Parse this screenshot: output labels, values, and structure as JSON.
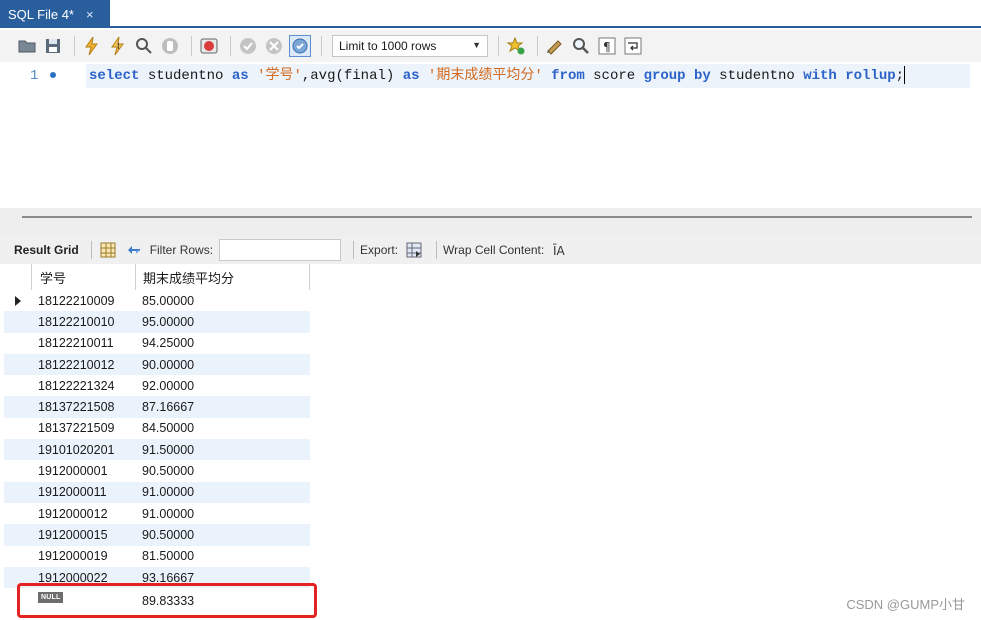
{
  "tab": {
    "label": "SQL File 4*",
    "close": "×"
  },
  "toolbar": {
    "limit_label": "Limit to 1000 rows",
    "icons": [
      "open-folder-icon",
      "save-icon",
      "execute-icon",
      "execute-current-icon",
      "explain-icon",
      "stop-icon",
      "stop-on-error-icon",
      "commit-icon",
      "rollback-icon",
      "autocommit-icon",
      "add-snippet-icon",
      "beautify-icon",
      "find-icon",
      "invisible-chars-icon",
      "wrap-icon"
    ]
  },
  "editor": {
    "line_number": "1",
    "tokens": [
      {
        "t": "select",
        "k": "kw"
      },
      {
        "t": " studentno ",
        "k": "plain"
      },
      {
        "t": "as",
        "k": "kw"
      },
      {
        "t": " ",
        "k": "plain"
      },
      {
        "t": "'学号'",
        "k": "str"
      },
      {
        "t": ",avg(final) ",
        "k": "plain"
      },
      {
        "t": "as",
        "k": "kw"
      },
      {
        "t": " ",
        "k": "plain"
      },
      {
        "t": "'期末成绩平均分'",
        "k": "str"
      },
      {
        "t": " ",
        "k": "plain"
      },
      {
        "t": "from",
        "k": "kw"
      },
      {
        "t": " score ",
        "k": "plain"
      },
      {
        "t": "group by",
        "k": "kw"
      },
      {
        "t": " studentno ",
        "k": "plain"
      },
      {
        "t": "with rollup",
        "k": "kw"
      },
      {
        "t": ";",
        "k": "plain"
      }
    ]
  },
  "result_toolbar": {
    "result_grid": "Result Grid",
    "filter_rows": "Filter Rows:",
    "export": "Export:",
    "wrap": "Wrap Cell Content:"
  },
  "grid": {
    "columns": [
      "学号",
      "期末成绩平均分"
    ],
    "rows": [
      [
        "18122210009",
        "85.00000"
      ],
      [
        "18122210010",
        "95.00000"
      ],
      [
        "18122210011",
        "94.25000"
      ],
      [
        "18122210012",
        "90.00000"
      ],
      [
        "18122221324",
        "92.00000"
      ],
      [
        "18137221508",
        "87.16667"
      ],
      [
        "18137221509",
        "84.50000"
      ],
      [
        "19101020201",
        "91.50000"
      ],
      [
        "1912000001",
        "90.50000"
      ],
      [
        "1912000011",
        "91.00000"
      ],
      [
        "1912000012",
        "91.00000"
      ],
      [
        "1912000015",
        "90.50000"
      ],
      [
        "1912000019",
        "81.50000"
      ],
      [
        "1912000022",
        "93.16667"
      ]
    ],
    "rollup_row": {
      "null_label": "NULL",
      "value": "89.83333"
    }
  },
  "watermark": "CSDN @GUMP小甘",
  "colors": {
    "tab": "#2a5f9e",
    "keyword": "#2b63c9",
    "string": "#d46a1c",
    "highlight": "#e52222"
  }
}
